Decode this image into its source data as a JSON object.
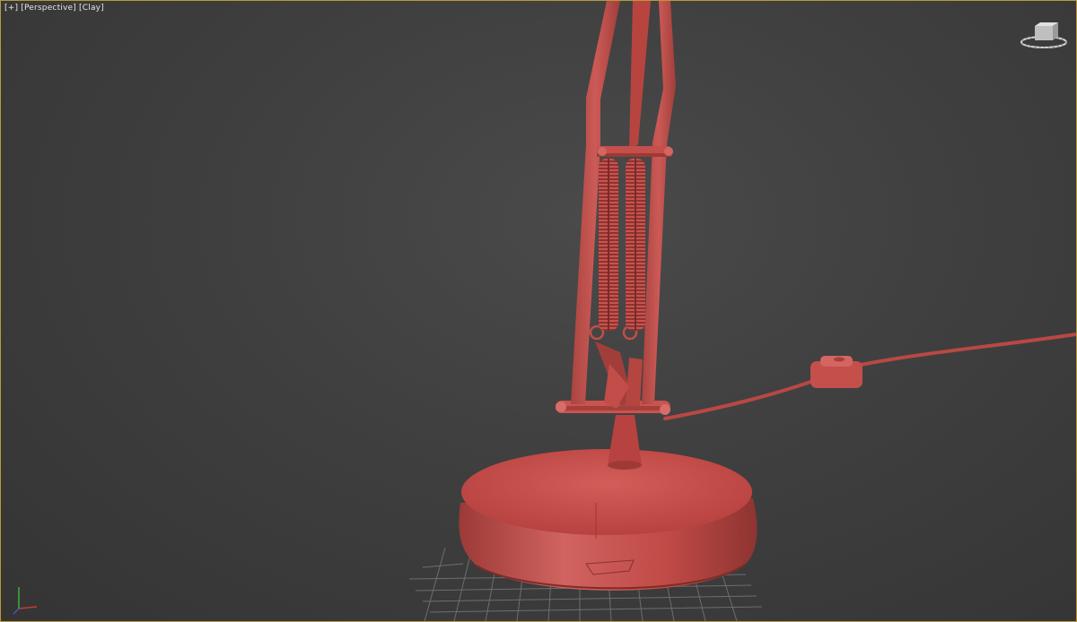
{
  "viewport": {
    "labels": {
      "plus": "[+]",
      "view": "[Perspective]",
      "shading": "[Clay]"
    },
    "grid_visible": true,
    "clay_color": "#c8504c"
  },
  "icons": {
    "viewcube": "viewcube-icon",
    "axis": "xyz-axis-tripod-icon"
  }
}
